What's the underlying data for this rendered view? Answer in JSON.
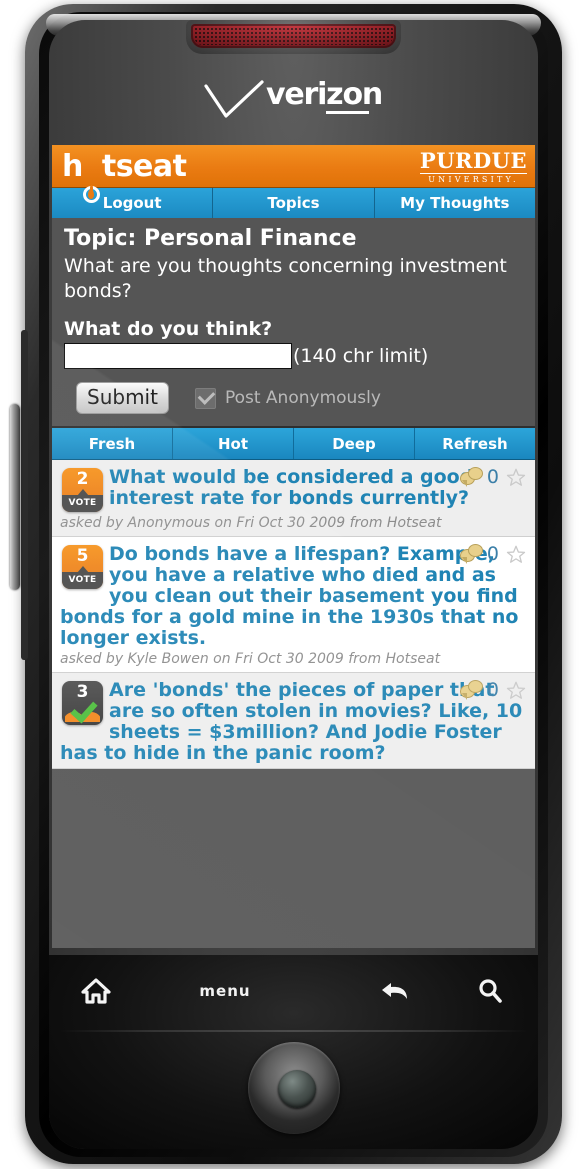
{
  "device": {
    "carrier_brand": "verizon",
    "hardware_buttons": [
      {
        "name": "home",
        "label": ""
      },
      {
        "name": "menu",
        "label": "menu"
      },
      {
        "name": "back",
        "label": ""
      },
      {
        "name": "search",
        "label": ""
      }
    ]
  },
  "app": {
    "name": "hotseat",
    "logo_text_before": "h",
    "logo_text_after": "tseat",
    "university": {
      "name": "PURDUE",
      "sub": "UNIVERSITY."
    },
    "colors": {
      "brand_orange": "#ea7b12",
      "brand_blue": "#1b8ac2",
      "link_blue": "#2084b4",
      "panel_grey": "#555555",
      "vote_orange": "#f2871d",
      "check_green": "#4dbe3c"
    }
  },
  "nav": {
    "items": [
      {
        "label": "Logout",
        "name": "logout"
      },
      {
        "label": "Topics",
        "name": "topics"
      },
      {
        "label": "My Thoughts",
        "name": "my-thoughts"
      }
    ]
  },
  "topic": {
    "title": "Topic: Personal Finance",
    "question": "What are you thoughts concerning investment bonds?",
    "compose_label": "What do you think?",
    "input_value": "",
    "input_placeholder": "",
    "char_limit_note": "(140 chr limit)",
    "submit_label": "Submit",
    "anonymous_label": "Post Anonymously",
    "anonymous_checked": true
  },
  "filters": {
    "items": [
      {
        "label": "Fresh",
        "name": "fresh"
      },
      {
        "label": "Hot",
        "name": "hot"
      },
      {
        "label": "Deep",
        "name": "deep"
      },
      {
        "label": "Refresh",
        "name": "refresh"
      }
    ]
  },
  "thoughts": [
    {
      "votes": "2",
      "vote_label": "VOTE",
      "voted": false,
      "text": "What would be considered a good interest rate for bonds currently?",
      "byline": "asked by Anonymous on Fri Oct 30 2009 from Hotseat",
      "comments": "0",
      "starred": false,
      "row_shade": true
    },
    {
      "votes": "5",
      "vote_label": "VOTE",
      "voted": false,
      "text": "Do bonds have a lifespan? Example, you have a relative who died and as you clean out their basement you find bonds for a gold mine in the 1930s that no longer exists.",
      "byline": "asked by Kyle Bowen on Fri Oct 30 2009 from Hotseat",
      "comments": "0",
      "starred": false,
      "row_shade": false
    },
    {
      "votes": "3",
      "vote_label": "",
      "voted": true,
      "text": "Are 'bonds' the pieces of paper that are so often stolen in movies? Like, 10 sheets = $3million? And Jodie Foster has to hide in the panic room?",
      "byline": "",
      "comments": "0",
      "starred": false,
      "row_shade": true
    }
  ]
}
